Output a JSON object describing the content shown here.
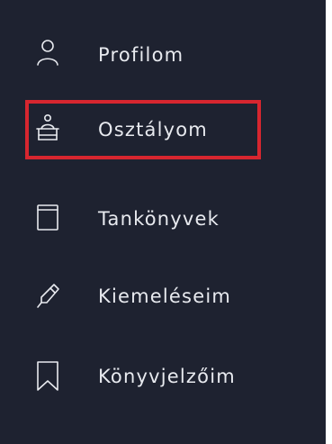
{
  "sidebar": {
    "items": [
      {
        "id": "profilom",
        "label": "Profilom",
        "icon": "user-icon",
        "active": false
      },
      {
        "id": "osztalyom",
        "label": "Osztályom",
        "icon": "classroom-icon",
        "active": true
      },
      {
        "id": "tankonyvek",
        "label": "Tankönyvek",
        "icon": "book-icon",
        "active": false
      },
      {
        "id": "kiemeleseim",
        "label": "Kiemeléseim",
        "icon": "highlighter-icon",
        "active": false
      },
      {
        "id": "konyvjelzoim",
        "label": "Könyvjelzőim",
        "icon": "bookmark-icon",
        "active": false
      }
    ]
  },
  "colors": {
    "background": "#1e2230",
    "text": "#e8eaef",
    "active_border": "#d7262f"
  }
}
